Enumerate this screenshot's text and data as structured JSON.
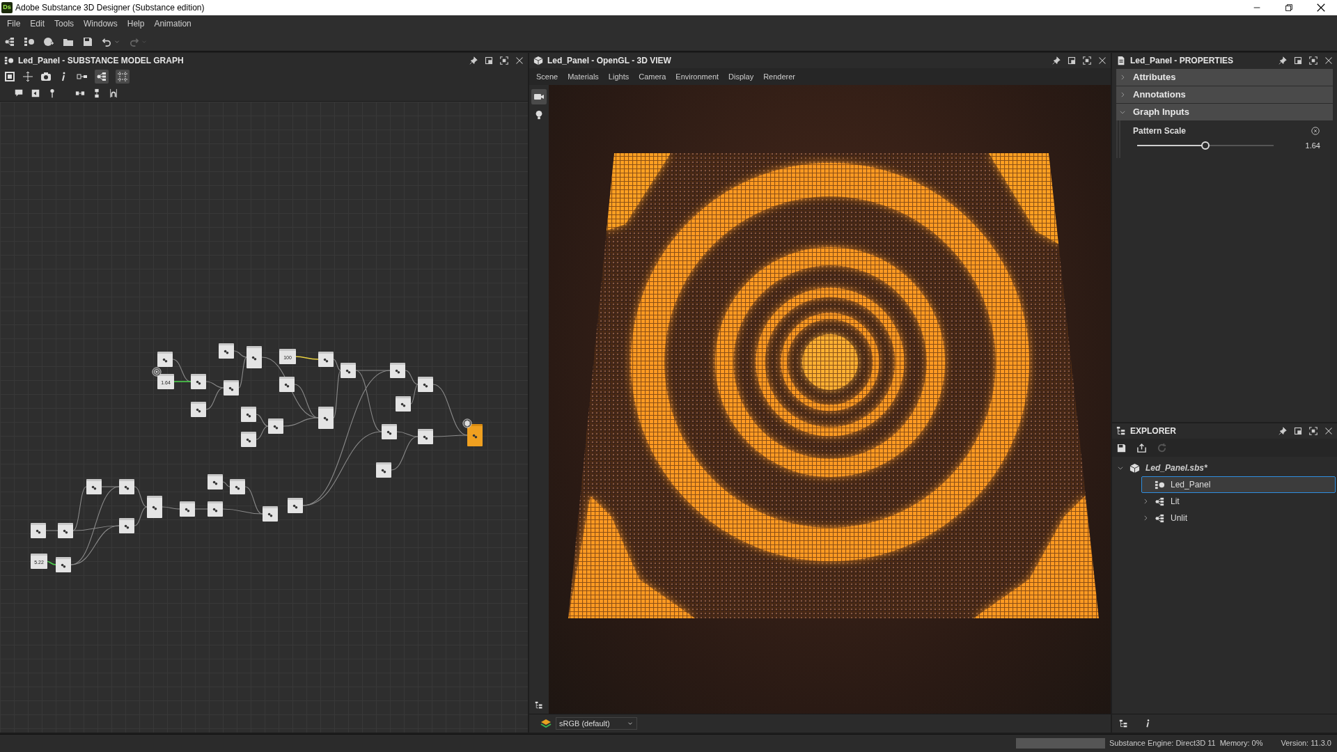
{
  "window": {
    "title": "Adobe Substance 3D Designer (Substance edition)",
    "app_badge": "Ds"
  },
  "menu": [
    "File",
    "Edit",
    "Tools",
    "Windows",
    "Help",
    "Animation"
  ],
  "graph_panel": {
    "title": "Led_Panel - SUBSTANCE MODEL GRAPH",
    "value_nodes": [
      "1.64",
      "100",
      "5.22"
    ]
  },
  "view_panel": {
    "title": "Led_Panel - OpenGL - 3D VIEW",
    "menu": [
      "Scene",
      "Materials",
      "Lights",
      "Camera",
      "Environment",
      "Display",
      "Renderer"
    ],
    "colorspace": "sRGB (default)"
  },
  "properties": {
    "title": "Led_Panel - PROPERTIES",
    "sections": [
      {
        "label": "Attributes",
        "expanded": false
      },
      {
        "label": "Annotations",
        "expanded": false
      },
      {
        "label": "Graph Inputs",
        "expanded": true
      }
    ],
    "parameter": {
      "label": "Pattern Scale",
      "level": 0.5,
      "value": "1.64"
    }
  },
  "explorer": {
    "title": "EXPLORER",
    "tree": [
      {
        "label": "Led_Panel.sbs*",
        "kind": "package",
        "expanded": true,
        "selected": false,
        "children": [
          {
            "label": "Led_Panel",
            "kind": "model_graph",
            "selected": true
          },
          {
            "label": "Lit",
            "kind": "graph",
            "expanded": false,
            "selected": false
          },
          {
            "label": "Unlit",
            "kind": "graph",
            "expanded": false,
            "selected": false
          }
        ]
      }
    ]
  },
  "status_bar": {
    "engine": "Substance Engine: Direct3D 11",
    "memory": "Memory: 0%",
    "version": "Version: 11.3.0"
  }
}
